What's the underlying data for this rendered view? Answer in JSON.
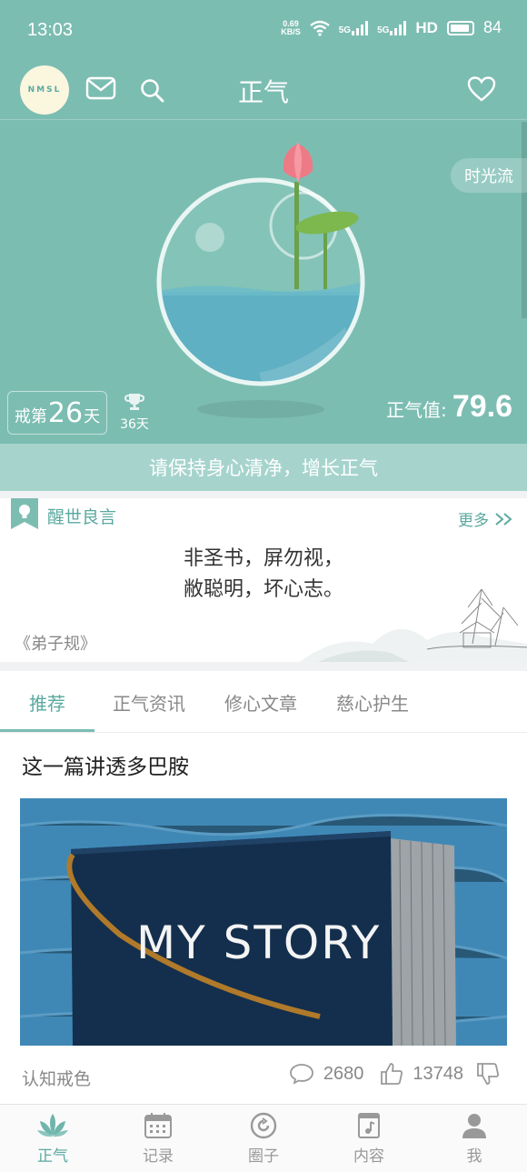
{
  "status": {
    "time": "13:03",
    "speed_top": "0.69",
    "speed_bottom": "KB/S",
    "sig1": "5G",
    "sig2": "5G",
    "hd": "HD",
    "battery": "84"
  },
  "header": {
    "avatar_text": "NMSL",
    "title": "正气"
  },
  "hero": {
    "timeline_label": "时光流",
    "days_prefix": "戒第",
    "days_value": "26",
    "days_suffix": "天",
    "trophy_days": "36天",
    "zq_label": "正气值:",
    "zq_value": "79.6",
    "progress_level": 0.45
  },
  "motto": "请保持身心清净，增长正气",
  "quote": {
    "heading": "醒世良言",
    "more": "更多",
    "line1": "非圣书，屏勿视，",
    "line2": "敝聪明，坏心志。",
    "source": "《弟子规》"
  },
  "tabs": [
    {
      "label": "推荐"
    },
    {
      "label": "正气资讯"
    },
    {
      "label": "修心文章"
    },
    {
      "label": "慈心护生"
    }
  ],
  "article": {
    "title": "这一篇讲透多巴胺",
    "image_text": "MY STORY",
    "category": "认知戒色",
    "comments": "2680",
    "likes": "13748"
  },
  "bottom_nav": [
    {
      "label": "正气",
      "icon": "lotus-icon"
    },
    {
      "label": "记录",
      "icon": "calendar-icon"
    },
    {
      "label": "圈子",
      "icon": "circle-refresh-icon"
    },
    {
      "label": "内容",
      "icon": "music-doc-icon"
    },
    {
      "label": "我",
      "icon": "user-icon"
    }
  ],
  "colors": {
    "primary": "#7cbdb2",
    "accent": "#5aa9a0",
    "motto_bar": "#a6d4cd"
  }
}
